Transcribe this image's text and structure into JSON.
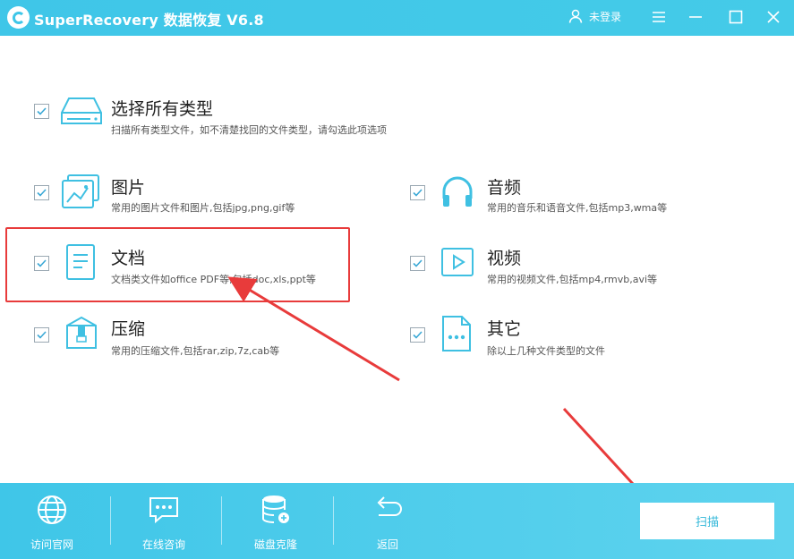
{
  "app": {
    "title": "SuperRecovery 数据恢复 V6.8"
  },
  "user": {
    "label": "未登录"
  },
  "options": {
    "all": {
      "title": "选择所有类型",
      "desc": "扫描所有类型文件，如不清楚找回的文件类型，请勾选此项选项",
      "checked": true
    },
    "image": {
      "title": "图片",
      "desc": "常用的图片文件和图片,包括jpg,png,gif等",
      "checked": true
    },
    "audio": {
      "title": "音频",
      "desc": "常用的音乐和语音文件,包括mp3,wma等",
      "checked": true
    },
    "doc": {
      "title": "文档",
      "desc": "文档类文件如office PDF等,包括doc,xls,ppt等",
      "checked": true
    },
    "video": {
      "title": "视频",
      "desc": "常用的视频文件,包括mp4,rmvb,avi等",
      "checked": true
    },
    "archive": {
      "title": "压缩",
      "desc": "常用的压缩文件,包括rar,zip,7z,cab等",
      "checked": true
    },
    "other": {
      "title": "其它",
      "desc": "除以上几种文件类型的文件",
      "checked": true
    }
  },
  "bottom": {
    "website": "访问官网",
    "consult": "在线咨询",
    "clone": "磁盘克隆",
    "back": "返回",
    "scan": "扫描"
  },
  "colors": {
    "accent": "#3fc6e8",
    "annotation": "#e83b3b"
  }
}
